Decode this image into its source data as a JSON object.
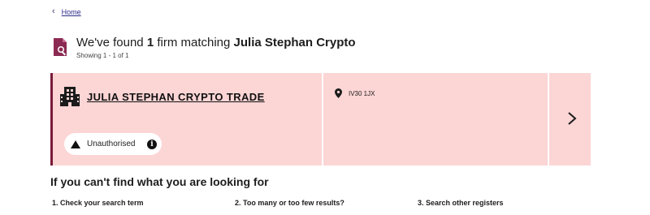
{
  "breadcrumb": {
    "home_label": "Home"
  },
  "results": {
    "prefix": "We've found ",
    "count": "1",
    "middle": " firm matching ",
    "query": "Julia Stephan Crypto",
    "showing": "Showing 1 - 1 of 1"
  },
  "firm": {
    "name": "JULIA STEPHAN CRYPTO TRADE",
    "status": "Unauthorised",
    "postcode": "IV30 1JX"
  },
  "help": {
    "title": "If you can't find what you are looking for",
    "steps": [
      "1. Check your search term",
      "2. Too many or too few results?",
      "3. Search other registers"
    ]
  },
  "colors": {
    "card_bg": "#fcd5d5",
    "card_accent": "#7a1a3a",
    "link": "#2d2d8c"
  },
  "icons": [
    "chevron-left-icon",
    "document-search-icon",
    "building-icon",
    "warning-icon",
    "info-icon",
    "location-pin-icon",
    "chevron-right-icon"
  ]
}
